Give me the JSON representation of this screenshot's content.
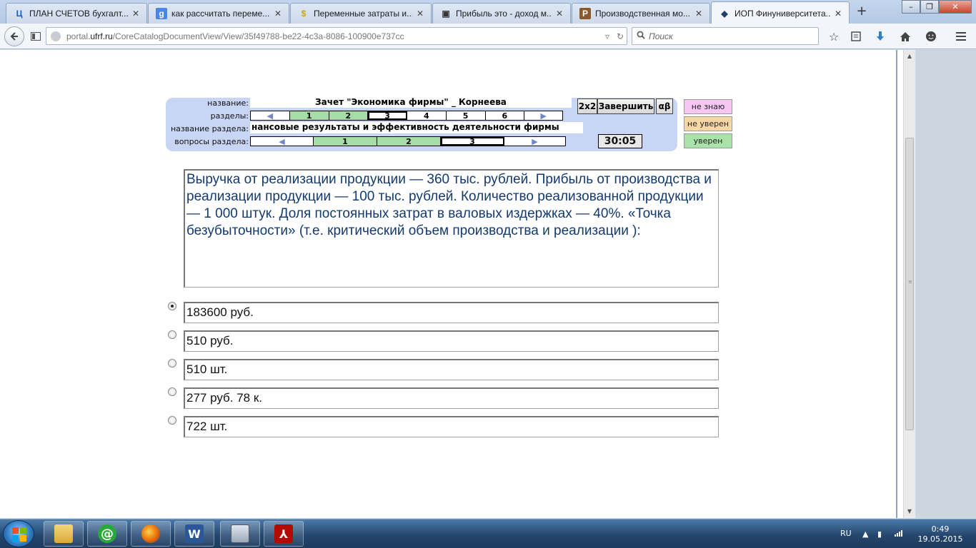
{
  "browser": {
    "tabs": [
      {
        "label": "ПЛАН СЧЕТОВ бухгалт...",
        "favicon_text": "Ц",
        "favicon_color": "#1c5bb3"
      },
      {
        "label": "как рассчитать переме...",
        "favicon_text": "g",
        "favicon_color": "#4a86e8"
      },
      {
        "label": "Переменные затраты и...",
        "favicon_text": "$",
        "favicon_color": "#d4a017"
      },
      {
        "label": "Прибыль это - доход м...",
        "favicon_text": "▣",
        "favicon_color": "#333333"
      },
      {
        "label": "Производственная мо...",
        "favicon_text": "P",
        "favicon_color": "#8a5a2b"
      },
      {
        "label": "ИОП Финуниверситета...",
        "favicon_text": "◆",
        "favicon_color": "#1f3c66",
        "active": true
      }
    ],
    "tab_close_glyph": "✕",
    "new_tab_glyph": "+",
    "window_buttons": {
      "minimize": "–",
      "restore": "❐",
      "close": "✕"
    },
    "url_prefix": "portal.",
    "url_domain": "ufrf.ru",
    "url_path": "/CoreCatalogDocumentView/View/35f49788-be22-4c3a-8086-100900e737cc",
    "search_placeholder": "Поиск",
    "icons": [
      "back-icon",
      "reader-icon",
      "site-info-icon",
      "dropdown-icon",
      "reload-icon",
      "search-icon",
      "bookmark-star-icon",
      "reading-list-icon",
      "download-icon",
      "home-icon",
      "smiley-icon",
      "menu-icon"
    ]
  },
  "test_panel": {
    "labels": {
      "name": "название:",
      "sections": "разделы:",
      "section_name": "название раздела:",
      "section_questions": "вопросы раздела:"
    },
    "test_name": "Зачет \"Экономика фирмы\" _ Корнеева",
    "sections": [
      {
        "label": "◀",
        "state": "arrow"
      },
      {
        "label": "1",
        "state": "done"
      },
      {
        "label": "2",
        "state": "done"
      },
      {
        "label": "3",
        "state": "current"
      },
      {
        "label": "4",
        "state": "open"
      },
      {
        "label": "5",
        "state": "open"
      },
      {
        "label": "6",
        "state": "open"
      },
      {
        "label": "▶",
        "state": "arrow"
      }
    ],
    "section_name": "нансовые результаты и эффективность деятельности   фирмы",
    "questions": [
      {
        "label": "◀",
        "state": "arrow"
      },
      {
        "label": "1",
        "state": "done"
      },
      {
        "label": "2",
        "state": "done"
      },
      {
        "label": "3",
        "state": "current"
      },
      {
        "label": "▶",
        "state": "arrow"
      }
    ],
    "buttons": {
      "grid": "2x2",
      "finish": "Завершить",
      "alpha_beta": "αβ"
    },
    "timer": "30:05",
    "confidence": [
      {
        "label": "не знаю",
        "color": "#f7c6f2"
      },
      {
        "label": "не уверен",
        "color": "#f8d7a5"
      },
      {
        "label": "уверен",
        "color": "#a9e3a9"
      }
    ]
  },
  "question": {
    "text": "Выручка от реализации продукции — 360 тыс. рублей. Прибыль от производства и реализации продукции — 100 тыс. рублей. Количество реализованной продукции — 1 000 штук. Доля постоянных затрат в валовых издержках — 40%. «Точка безубыточности»  (т.е. критический объем производства и реализации ):"
  },
  "answers": [
    {
      "text": "183600 руб.",
      "selected": true
    },
    {
      "text": "510 руб.",
      "selected": false
    },
    {
      "text": "510 шт.",
      "selected": false
    },
    {
      "text": "277 руб. 78 к.",
      "selected": false
    },
    {
      "text": "722 шт.",
      "selected": false
    }
  ],
  "taskbar": {
    "apps": [
      "explorer-icon",
      "mail-agent-icon",
      "firefox-icon",
      "word-icon",
      "calculator-icon",
      "acrobat-icon"
    ],
    "app_glyphs": [
      "",
      "@",
      "",
      "W",
      "",
      "⅄"
    ],
    "lang": "RU",
    "time": "0:49",
    "date": "19.05.2015"
  }
}
